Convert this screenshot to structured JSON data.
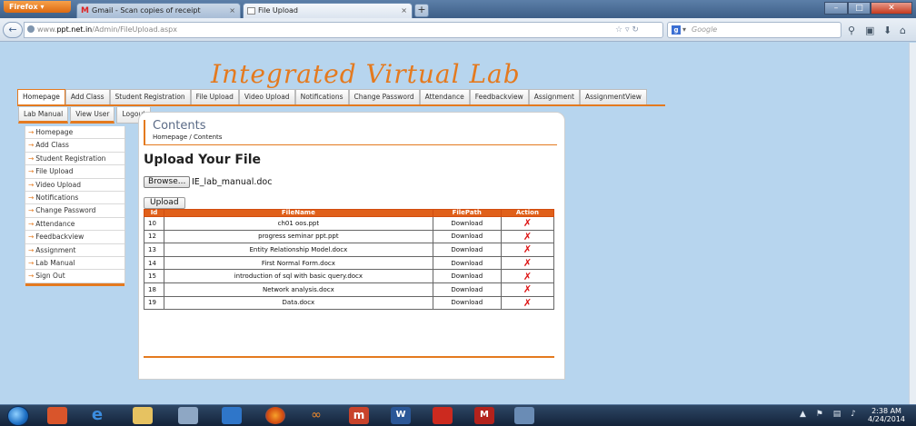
{
  "browser": {
    "firefox_label": "Firefox",
    "tabs": [
      {
        "label": "Gmail - Scan copies of receipt",
        "close": "×"
      },
      {
        "label": "File Upload",
        "close": "×"
      }
    ],
    "new_tab": "+",
    "url_prefix": "www.",
    "url_host": "ppt.net.in",
    "url_path": "/Admin/FileUpload.aspx",
    "search_placeholder": "Google",
    "search_engine_letter": "g"
  },
  "site": {
    "title": "Integrated Virtual Lab",
    "menu": [
      "Homepage",
      "Add Class",
      "Student Registration",
      "File Upload",
      "Video Upload",
      "Notifications",
      "Change Password",
      "Attendance",
      "Feedbackview",
      "Assignment",
      "AssignmentView"
    ],
    "submenu": [
      "Lab Manual",
      "View User",
      "Logout"
    ],
    "sidebar": [
      "Homepage",
      "Add Class",
      "Student Registration",
      "File Upload",
      "Video Upload",
      "Notifications",
      "Change Password",
      "Attendance",
      "Feedbackview",
      "Assignment",
      "Lab Manual",
      "Sign Out"
    ],
    "sidebar_arrow": "→"
  },
  "content": {
    "heading": "Contents",
    "breadcrumb": "Homepage / Contents",
    "upload_title": "Upload Your File",
    "browse_label": "Browse...",
    "selected_file": "IE_lab_manual.doc",
    "upload_label": "Upload",
    "table": {
      "headers": [
        "Id",
        "FileName",
        "FilePath",
        "Action"
      ],
      "rows": [
        {
          "id": "10",
          "name": "ch01 oos.ppt",
          "path": "Download",
          "action": "✗"
        },
        {
          "id": "12",
          "name": "progress seminar ppt.ppt",
          "path": "Download",
          "action": "✗"
        },
        {
          "id": "13",
          "name": "Entity Relationship Model.docx",
          "path": "Download",
          "action": "✗"
        },
        {
          "id": "14",
          "name": "First Normal Form.docx",
          "path": "Download",
          "action": "✗"
        },
        {
          "id": "15",
          "name": "introduction of sql with basic query.docx",
          "path": "Download",
          "action": "✗"
        },
        {
          "id": "18",
          "name": "Network analysis.docx",
          "path": "Download",
          "action": "✗"
        },
        {
          "id": "19",
          "name": "Data.docx",
          "path": "Download",
          "action": "✗"
        }
      ]
    }
  },
  "taskbar": {
    "time": "2:38 AM",
    "date": "4/24/2014"
  },
  "colors": {
    "accent": "#e47a1f",
    "table_header": "#e0601a",
    "page_bg": "#b7d5ee"
  }
}
